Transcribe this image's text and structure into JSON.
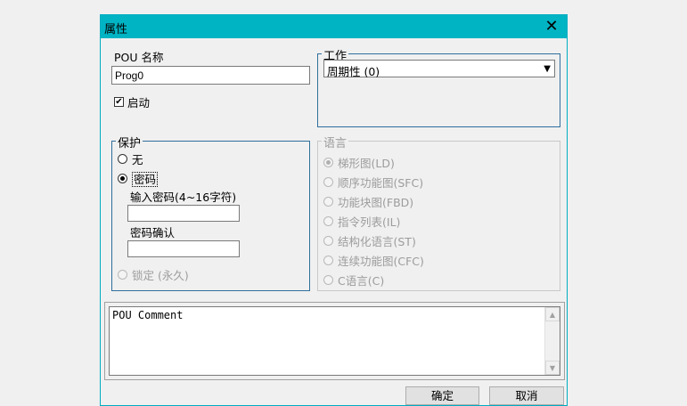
{
  "window": {
    "title": "属性",
    "close_glyph": "✕"
  },
  "pou": {
    "name_label": "POU 名称",
    "name_value": "Prog0",
    "enable_label": "启动",
    "enable_checked": true
  },
  "task": {
    "group_label": "工作",
    "selected": "周期性 (0)",
    "arrow": "▼"
  },
  "protection": {
    "group_label": "保护",
    "options": [
      {
        "label": "无",
        "checked": false,
        "enabled": true
      },
      {
        "label": "密码",
        "checked": true,
        "enabled": true
      },
      {
        "label": "锁定 (永久)",
        "checked": false,
        "enabled": false
      }
    ],
    "password_label": "输入密码(4~16字符)",
    "password_value": "",
    "confirm_label": "密码确认",
    "confirm_value": ""
  },
  "language": {
    "group_label": "语言",
    "options": [
      {
        "label": "梯形图(LD)",
        "checked": true
      },
      {
        "label": "顺序功能图(SFC)",
        "checked": false
      },
      {
        "label": "功能块图(FBD)",
        "checked": false
      },
      {
        "label": "指令列表(IL)",
        "checked": false
      },
      {
        "label": "结构化语言(ST)",
        "checked": false
      },
      {
        "label": "连续功能图(CFC)",
        "checked": false
      },
      {
        "label": "C语言(C)",
        "checked": false
      }
    ]
  },
  "comment": {
    "text": "POU Comment",
    "scroll_up": "▲",
    "scroll_down": "▼"
  },
  "buttons": {
    "ok": "确定",
    "cancel": "取消"
  },
  "colors": {
    "titlebar": "#00b4c4",
    "group_border": "#2f6e9c"
  }
}
